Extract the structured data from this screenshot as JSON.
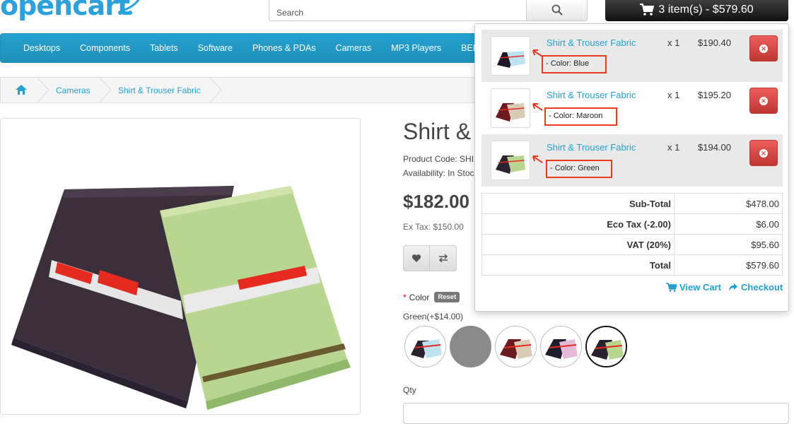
{
  "header": {
    "logo_text": "opencart",
    "search_placeholder": "Search",
    "cart_button_label": "3 item(s) - $579.60"
  },
  "menu": {
    "items": [
      "Desktops",
      "Components",
      "Tablets",
      "Software",
      "Phones & PDAs",
      "Cameras",
      "MP3 Players",
      "BEL"
    ]
  },
  "breadcrumb": {
    "items": [
      "Cameras",
      "Shirt & Trouser Fabric"
    ]
  },
  "product": {
    "title": "Shirt &",
    "product_code": "Product Code: SHI",
    "availability": "Availability: In Stoc",
    "price": "$182.00",
    "ex_tax": "Ex Tax: $150.00",
    "color_label": "Color",
    "reset_label": "Reset",
    "selected_color": "Green(+$14.00)",
    "qty_label": "Qty"
  },
  "cart_dropdown": {
    "items": [
      {
        "name": "Shirt & Trouser Fabric",
        "option": "- Color: Blue",
        "qty": "x 1",
        "price": "$190.40"
      },
      {
        "name": "Shirt & Trouser Fabric",
        "option": "- Color: Maroon",
        "qty": "x 1",
        "price": "$195.20"
      },
      {
        "name": "Shirt & Trouser Fabric",
        "option": "- Color: Green",
        "qty": "x 1",
        "price": "$194.00"
      }
    ],
    "totals": [
      {
        "label": "Sub-Total",
        "value": "$478.00"
      },
      {
        "label": "Eco Tax (-2.00)",
        "value": "$6.00"
      },
      {
        "label": "VAT (20%)",
        "value": "$95.60"
      },
      {
        "label": "Total",
        "value": "$579.60"
      }
    ],
    "view_cart_label": "View Cart",
    "checkout_label": "Checkout"
  },
  "colors": {
    "accent": "#23a1d1",
    "danger": "#d9534f",
    "highlight_box": "#e83a1f"
  }
}
